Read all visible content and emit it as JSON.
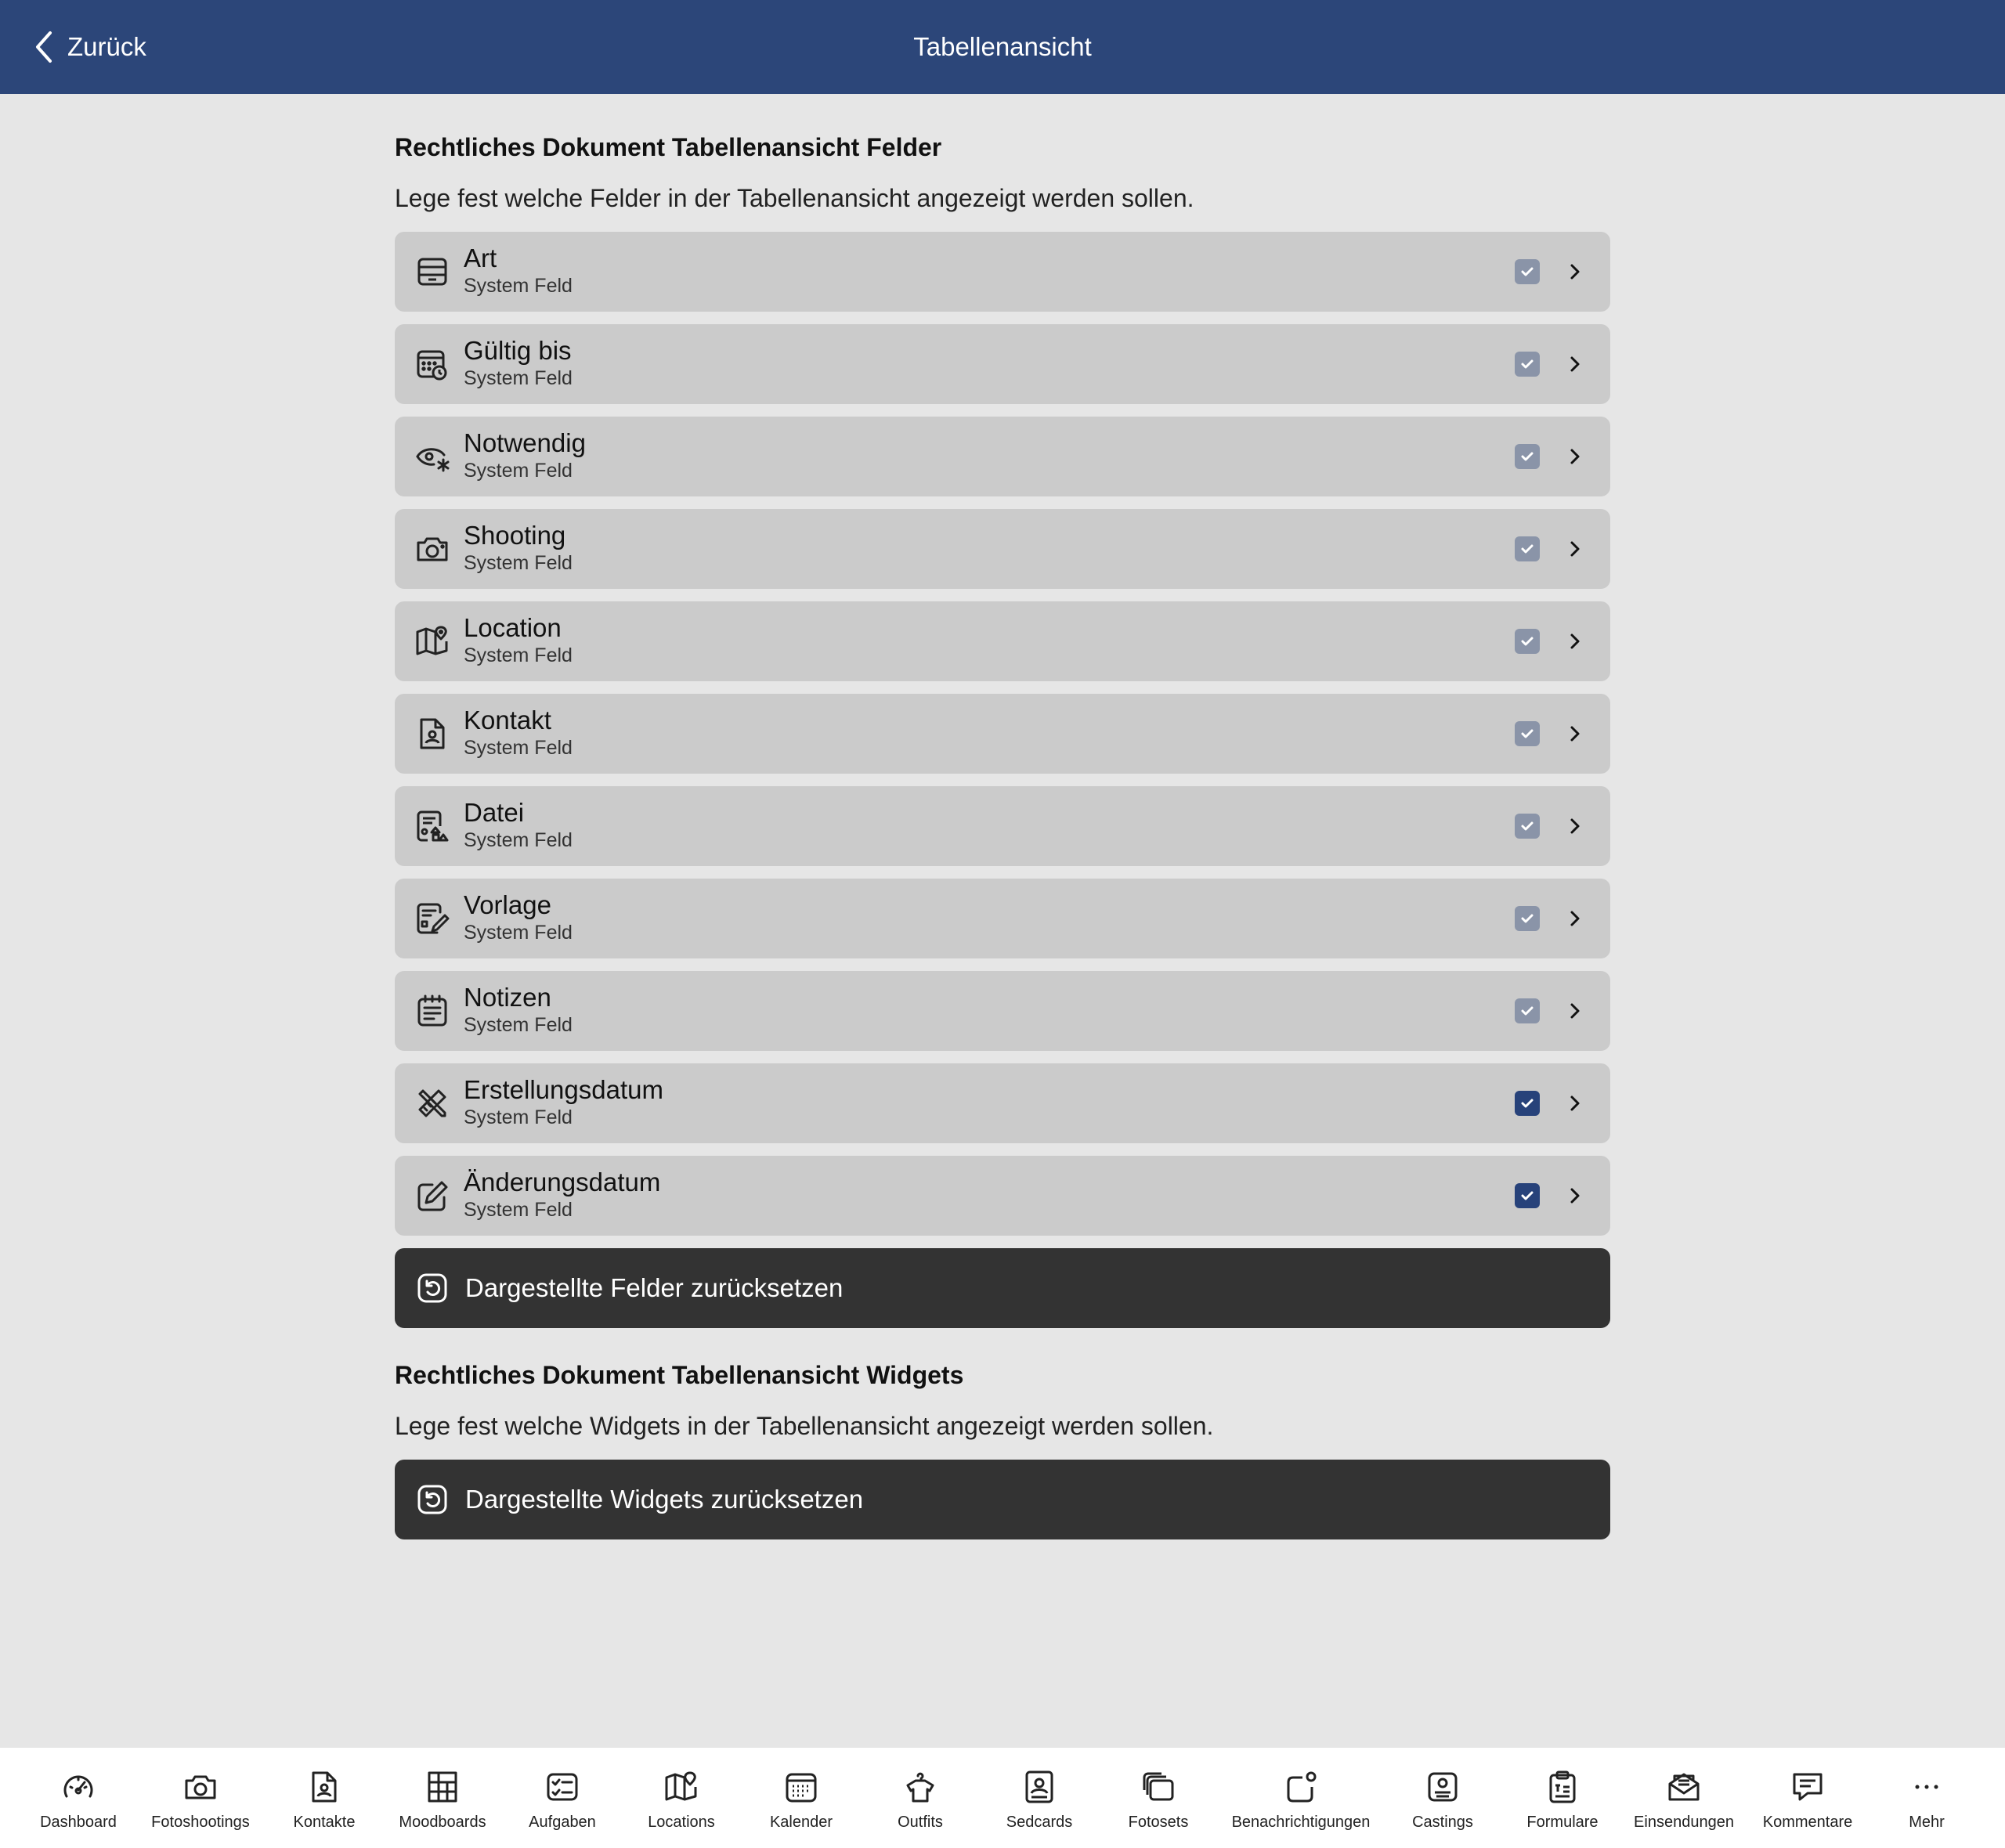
{
  "navbar": {
    "back_label": "Zurück",
    "title": "Tabellenansicht",
    "background": "#2c4679"
  },
  "fields_section": {
    "title": "Rechtliches Dokument Tabellenansicht Felder",
    "description": "Lege fest welche Felder in der Tabellenansicht angezeigt werden sollen.",
    "items": [
      {
        "name": "Art",
        "subtitle": "System Feld",
        "icon": "tray-icon",
        "checked": true,
        "locked": true
      },
      {
        "name": "Gültig bis",
        "subtitle": "System Feld",
        "icon": "calendar-clock-icon",
        "checked": true,
        "locked": true
      },
      {
        "name": "Notwendig",
        "subtitle": "System Feld",
        "icon": "eye-asterisk-icon",
        "checked": true,
        "locked": true
      },
      {
        "name": "Shooting",
        "subtitle": "System Feld",
        "icon": "camera-icon",
        "checked": true,
        "locked": true
      },
      {
        "name": "Location",
        "subtitle": "System Feld",
        "icon": "map-pin-icon",
        "checked": true,
        "locked": true
      },
      {
        "name": "Kontakt",
        "subtitle": "System Feld",
        "icon": "contact-file-icon",
        "checked": true,
        "locked": true
      },
      {
        "name": "Datei",
        "subtitle": "System Feld",
        "icon": "file-shapes-icon",
        "checked": true,
        "locked": true
      },
      {
        "name": "Vorlage",
        "subtitle": "System Feld",
        "icon": "template-edit-icon",
        "checked": true,
        "locked": true
      },
      {
        "name": "Notizen",
        "subtitle": "System Feld",
        "icon": "notepad-icon",
        "checked": true,
        "locked": true
      },
      {
        "name": "Erstellungsdatum",
        "subtitle": "System Feld",
        "icon": "pencil-ruler-icon",
        "checked": true,
        "locked": false
      },
      {
        "name": "Änderungsdatum",
        "subtitle": "System Feld",
        "icon": "edit-square-icon",
        "checked": true,
        "locked": false
      }
    ],
    "reset_label": "Dargestellte Felder zurücksetzen"
  },
  "widgets_section": {
    "title": "Rechtliches Dokument Tabellenansicht Widgets",
    "description": "Lege fest welche Widgets in der Tabellenansicht angezeigt werden sollen.",
    "reset_label": "Dargestellte Widgets zurücksetzen"
  },
  "tabbar": {
    "items": [
      {
        "label": "Dashboard",
        "icon": "gauge-icon"
      },
      {
        "label": "Fotoshootings",
        "icon": "camera-icon"
      },
      {
        "label": "Kontakte",
        "icon": "contact-file-icon"
      },
      {
        "label": "Moodboards",
        "icon": "grid-board-icon"
      },
      {
        "label": "Aufgaben",
        "icon": "checklist-icon"
      },
      {
        "label": "Locations",
        "icon": "map-pin-icon"
      },
      {
        "label": "Kalender",
        "icon": "calendar-icon"
      },
      {
        "label": "Outfits",
        "icon": "hanger-shirt-icon"
      },
      {
        "label": "Sedcards",
        "icon": "id-card-icon"
      },
      {
        "label": "Fotosets",
        "icon": "photo-stack-icon"
      },
      {
        "label": "Benachrichtigungen",
        "icon": "notification-icon"
      },
      {
        "label": "Castings",
        "icon": "casting-icon"
      },
      {
        "label": "Formulare",
        "icon": "clipboard-icon"
      },
      {
        "label": "Einsendungen",
        "icon": "envelope-open-icon"
      },
      {
        "label": "Kommentare",
        "icon": "comment-icon"
      },
      {
        "label": "Mehr",
        "icon": "more-dots-icon"
      }
    ]
  }
}
